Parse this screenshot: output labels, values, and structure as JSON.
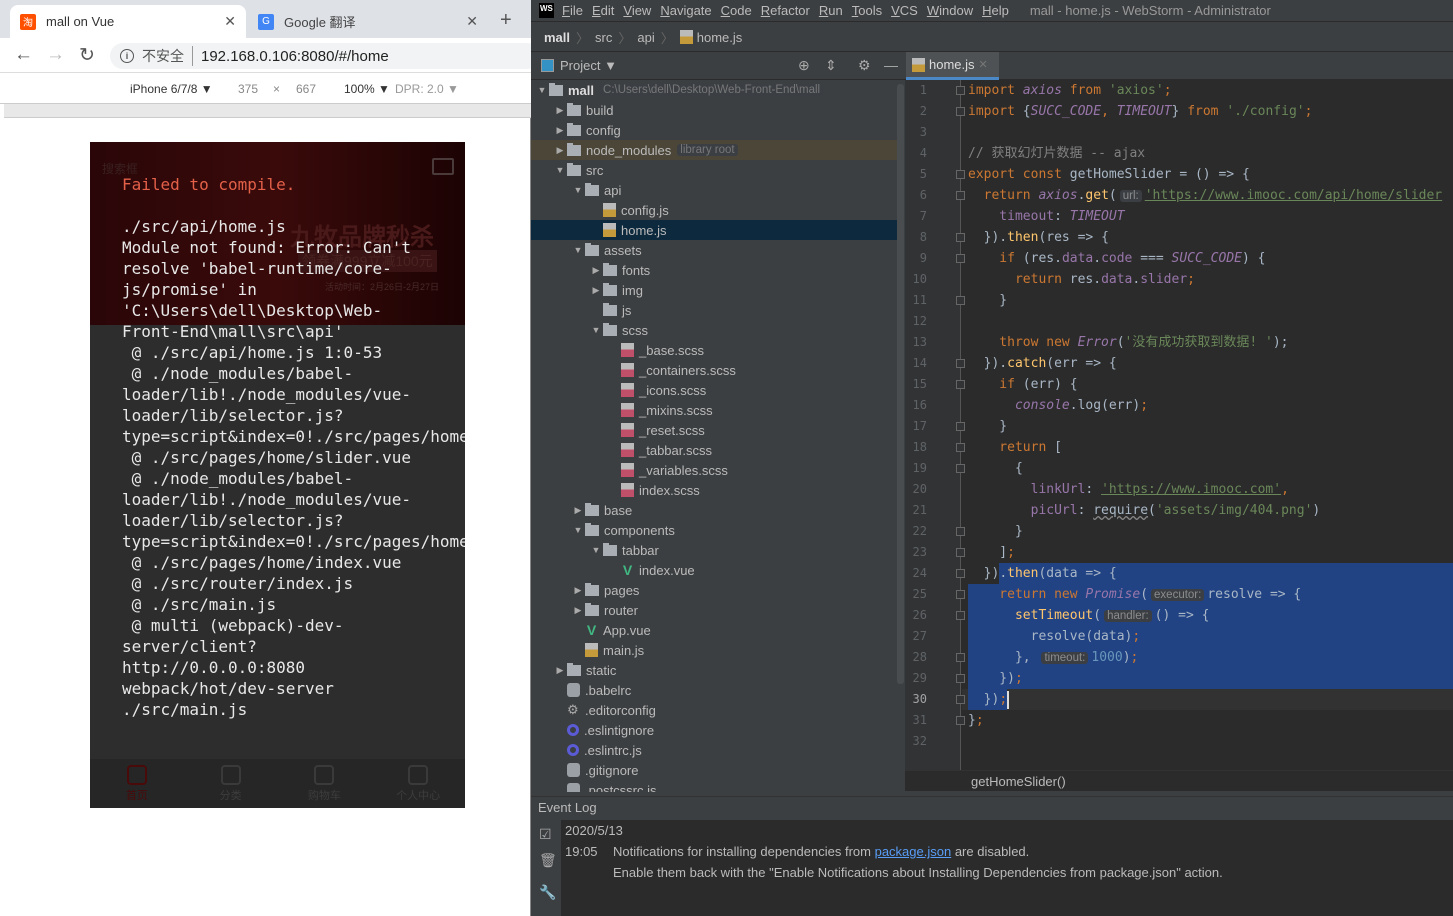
{
  "browser": {
    "tabs": [
      {
        "title": "mall on Vue",
        "favicon": "淘",
        "favicon_color": "#ff5000",
        "active": true
      },
      {
        "title": "Google 翻译",
        "favicon": "G",
        "favicon_color": "#4285f4",
        "active": false
      }
    ],
    "insecure_label": "不安全",
    "url": "192.168.0.106:8080/#/home",
    "device": {
      "name": "iPhone 6/7/8 ▼",
      "width": "375",
      "times": "×",
      "height": "667",
      "zoom": "100% ▼",
      "dpr": "DPR: 2.0 ▼"
    }
  },
  "phone": {
    "background": {
      "search": "搜索框",
      "promo_title": "九牧品牌秒杀",
      "promo_sub": "领券满999立减100元",
      "promo_date": "活动时间：2月26日-2月27日"
    },
    "error_title": "Failed to compile.",
    "error_lines": [
      "",
      "./src/api/home.js",
      "Module not found: Error: Can't",
      "resolve 'babel-runtime/core-",
      "js/promise' in",
      "'C:\\Users\\dell\\Desktop\\Web-",
      "Front-End\\mall\\src\\api'",
      " @ ./src/api/home.js 1:0-53",
      " @ ./node_modules/babel-",
      "loader/lib!./node_modules/vue-",
      "loader/lib/selector.js?",
      "type=script&index=0!./src/pages/home",
      " @ ./src/pages/home/slider.vue",
      " @ ./node_modules/babel-",
      "loader/lib!./node_modules/vue-",
      "loader/lib/selector.js?",
      "type=script&index=0!./src/pages/home",
      " @ ./src/pages/home/index.vue",
      " @ ./src/router/index.js",
      " @ ./src/main.js",
      " @ multi (webpack)-dev-",
      "server/client?",
      "http://0.0.0.0:8080",
      "webpack/hot/dev-server",
      "./src/main.js"
    ],
    "tabbar": [
      {
        "label": "首页",
        "icon": "home-icon",
        "active": true
      },
      {
        "label": "分类",
        "icon": "category-icon",
        "active": false
      },
      {
        "label": "购物车",
        "icon": "cart-icon",
        "active": false
      },
      {
        "label": "个人中心",
        "icon": "user-icon",
        "active": false
      }
    ]
  },
  "ide": {
    "logo": "WS",
    "menu": [
      "File",
      "Edit",
      "View",
      "Navigate",
      "Code",
      "Refactor",
      "Run",
      "Tools",
      "VCS",
      "Window",
      "Help"
    ],
    "window_title": "mall - home.js - WebStorm - Administrator",
    "breadcrumbs": [
      "mall",
      "src",
      "api",
      "home.js"
    ],
    "project_label": "Project ▼",
    "editor_tab": "home.js",
    "tree": [
      {
        "d": 0,
        "name": "mall",
        "type": "folder",
        "open": true,
        "bold": true,
        "hint": "C:\\Users\\dell\\Desktop\\Web-Front-End\\mall"
      },
      {
        "d": 1,
        "name": "build",
        "type": "folder",
        "open": false
      },
      {
        "d": 1,
        "name": "config",
        "type": "folder",
        "open": false
      },
      {
        "d": 1,
        "name": "node_modules",
        "type": "folder",
        "open": false,
        "hint": "library root",
        "lib": true
      },
      {
        "d": 1,
        "name": "src",
        "type": "folder",
        "open": true
      },
      {
        "d": 2,
        "name": "api",
        "type": "folder",
        "open": true
      },
      {
        "d": 3,
        "name": "config.js",
        "type": "js"
      },
      {
        "d": 3,
        "name": "home.js",
        "type": "js",
        "selected": true
      },
      {
        "d": 2,
        "name": "assets",
        "type": "folder",
        "open": true
      },
      {
        "d": 3,
        "name": "fonts",
        "type": "folder",
        "open": false
      },
      {
        "d": 3,
        "name": "img",
        "type": "folder",
        "open": false
      },
      {
        "d": 3,
        "name": "js",
        "type": "folder"
      },
      {
        "d": 3,
        "name": "scss",
        "type": "folder",
        "open": true
      },
      {
        "d": 4,
        "name": "_base.scss",
        "type": "scss"
      },
      {
        "d": 4,
        "name": "_containers.scss",
        "type": "scss"
      },
      {
        "d": 4,
        "name": "_icons.scss",
        "type": "scss"
      },
      {
        "d": 4,
        "name": "_mixins.scss",
        "type": "scss"
      },
      {
        "d": 4,
        "name": "_reset.scss",
        "type": "scss"
      },
      {
        "d": 4,
        "name": "_tabbar.scss",
        "type": "scss"
      },
      {
        "d": 4,
        "name": "_variables.scss",
        "type": "scss"
      },
      {
        "d": 4,
        "name": "index.scss",
        "type": "scss"
      },
      {
        "d": 2,
        "name": "base",
        "type": "folder",
        "open": false
      },
      {
        "d": 2,
        "name": "components",
        "type": "folder",
        "open": true
      },
      {
        "d": 3,
        "name": "tabbar",
        "type": "folder",
        "open": true
      },
      {
        "d": 4,
        "name": "index.vue",
        "type": "vue"
      },
      {
        "d": 2,
        "name": "pages",
        "type": "folder",
        "open": false
      },
      {
        "d": 2,
        "name": "router",
        "type": "folder",
        "open": false
      },
      {
        "d": 2,
        "name": "App.vue",
        "type": "vue"
      },
      {
        "d": 2,
        "name": "main.js",
        "type": "js"
      },
      {
        "d": 1,
        "name": "static",
        "type": "folder",
        "open": false
      },
      {
        "d": 1,
        "name": ".babelrc",
        "type": "cfg"
      },
      {
        "d": 1,
        "name": ".editorconfig",
        "type": "gear"
      },
      {
        "d": 1,
        "name": ".eslintignore",
        "type": "eslint"
      },
      {
        "d": 1,
        "name": ".eslintrc.js",
        "type": "eslint"
      },
      {
        "d": 1,
        "name": ".gitignore",
        "type": "cfg"
      },
      {
        "d": 1,
        "name": ".postcssrc.js",
        "type": "cfg"
      }
    ],
    "current_line": 30,
    "code": [
      [
        [
          "import ",
          "kw"
        ],
        [
          "axios",
          "pi"
        ],
        [
          " from ",
          "kw"
        ],
        [
          "'axios'",
          "str"
        ],
        [
          ";",
          "kw"
        ]
      ],
      [
        [
          "import ",
          "kw"
        ],
        [
          "{",
          ""
        ],
        [
          "SUCC_CODE",
          "pi"
        ],
        [
          ", ",
          "kw"
        ],
        [
          "TIMEOUT",
          "pi"
        ],
        [
          "} ",
          ""
        ],
        [
          "from ",
          "kw"
        ],
        [
          "'./config'",
          "str"
        ],
        [
          ";",
          "kw"
        ]
      ],
      [],
      [
        [
          "// 获取幻灯片数据 -- ajax",
          "cm"
        ]
      ],
      [
        [
          "export const ",
          "kw"
        ],
        [
          "getHomeSlider",
          ""
        ],
        [
          " = () => {",
          ""
        ]
      ],
      [
        [
          "  return ",
          "kw"
        ],
        [
          "axios",
          "pi"
        ],
        [
          ".",
          ""
        ],
        [
          "get",
          "fn"
        ],
        [
          "(",
          ""
        ],
        [
          "url:",
          "hint"
        ],
        [
          "'https://www.imooc.com/api/home/slider",
          "strl"
        ]
      ],
      [
        [
          "    timeout",
          "pv"
        ],
        [
          ": ",
          ""
        ],
        [
          "TIMEOUT",
          "pi"
        ]
      ],
      [
        [
          "  }).",
          ""
        ],
        [
          "then",
          "fn"
        ],
        [
          "(res => {",
          ""
        ]
      ],
      [
        [
          "    if ",
          "kw"
        ],
        [
          "(res.",
          ""
        ],
        [
          "data",
          "pv"
        ],
        [
          ".",
          ""
        ],
        [
          "code",
          "pv"
        ],
        [
          " === ",
          ""
        ],
        [
          "SUCC_CODE",
          "pi"
        ],
        [
          ") {",
          ""
        ]
      ],
      [
        [
          "      return ",
          "kw"
        ],
        [
          "res.",
          ""
        ],
        [
          "data",
          "pv"
        ],
        [
          ".",
          ""
        ],
        [
          "slider",
          "pv"
        ],
        [
          ";",
          "kw"
        ]
      ],
      [
        [
          "    }",
          ""
        ]
      ],
      [],
      [
        [
          "    throw new ",
          "kw"
        ],
        [
          "Error",
          "pi"
        ],
        [
          "(",
          ""
        ],
        [
          "'没有成功获取到数据! '",
          "str"
        ],
        [
          ");",
          ""
        ]
      ],
      [
        [
          "  }).",
          ""
        ],
        [
          "catch",
          "fn"
        ],
        [
          "(err => {",
          ""
        ]
      ],
      [
        [
          "    if ",
          "kw"
        ],
        [
          "(err) {",
          ""
        ]
      ],
      [
        [
          "      ",
          ""
        ],
        [
          "console",
          "pi"
        ],
        [
          ".log(err)",
          ""
        ],
        [
          ";",
          "kw"
        ]
      ],
      [
        [
          "    }",
          ""
        ]
      ],
      [
        [
          "    return ",
          "kw"
        ],
        [
          "[",
          ""
        ]
      ],
      [
        [
          "      {",
          ""
        ]
      ],
      [
        [
          "        linkUrl",
          "pv"
        ],
        [
          ": ",
          ""
        ],
        [
          "'https://www.imooc.com'",
          "strl"
        ],
        [
          ",",
          "kw"
        ]
      ],
      [
        [
          "        picUrl",
          "pv"
        ],
        [
          ": ",
          ""
        ],
        [
          "require",
          "wavy"
        ],
        [
          "(",
          ""
        ],
        [
          "'assets/img/404.png'",
          "str"
        ],
        [
          ")",
          ""
        ]
      ],
      [
        [
          "      }",
          ""
        ]
      ],
      [
        [
          "    ]",
          ""
        ],
        [
          ";",
          "kw"
        ]
      ],
      [
        [
          "  })",
          ""
        ],
        [
          ".",
          ""
        ],
        [
          "then",
          "fn"
        ],
        [
          "(data => {",
          ""
        ]
      ],
      [
        [
          "    return new ",
          "kw"
        ],
        [
          "Promise",
          "pi"
        ],
        [
          "(",
          ""
        ],
        [
          "executor:",
          "hint"
        ],
        [
          "resolve => {",
          ""
        ]
      ],
      [
        [
          "      ",
          ""
        ],
        [
          "setTimeout",
          "fn"
        ],
        [
          "(",
          ""
        ],
        [
          "handler:",
          "hint"
        ],
        [
          "() => {",
          ""
        ]
      ],
      [
        [
          "        resolve(data)",
          ""
        ],
        [
          ";",
          "kw"
        ]
      ],
      [
        [
          "      },",
          ""
        ],
        [
          " ",
          ""
        ],
        [
          "timeout:",
          "hint"
        ],
        [
          "1000",
          "num"
        ],
        [
          ")",
          ""
        ],
        [
          ";",
          "kw"
        ]
      ],
      [
        [
          "    })",
          ""
        ],
        [
          ";",
          "kw"
        ]
      ],
      [
        [
          "  })",
          ""
        ],
        [
          ";",
          "kw"
        ]
      ],
      [
        [
          "}",
          ""
        ],
        [
          ";",
          "kw"
        ]
      ],
      []
    ],
    "editor_breadcrumb": "getHomeSlider()",
    "event_log": {
      "title": "Event Log",
      "date": "2020/5/13",
      "time": "19:05",
      "msg_before": "Notifications for installing dependencies from ",
      "msg_link": "package.json",
      "msg_after": " are disabled.",
      "msg_line2": "Enable them back with the \"Enable Notifications about Installing Dependencies from package.json\" action."
    }
  }
}
